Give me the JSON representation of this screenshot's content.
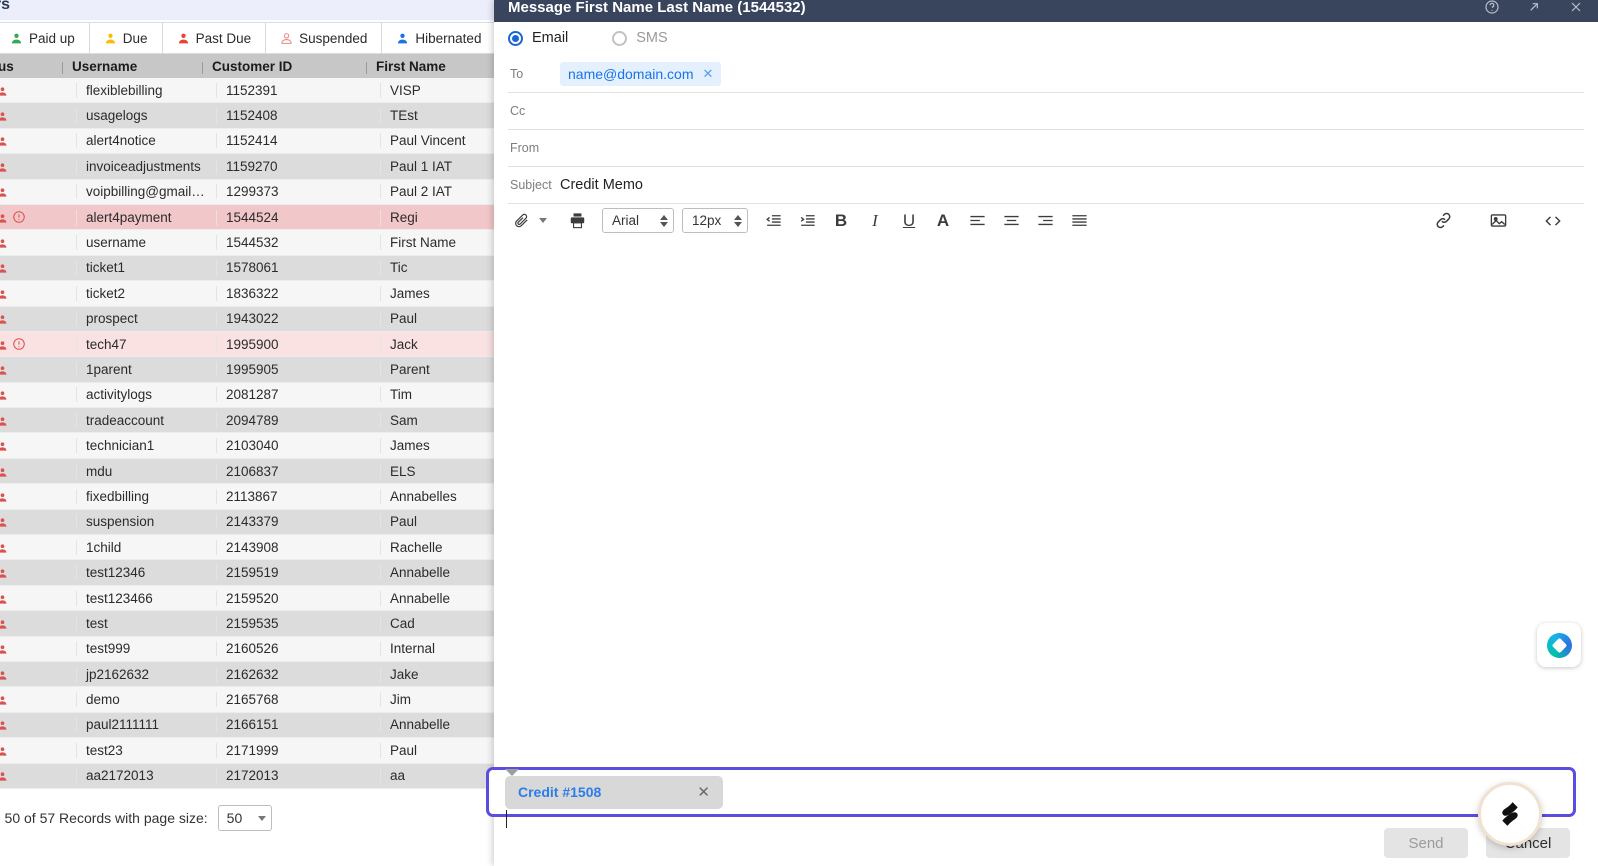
{
  "background_app": {
    "page_title": "ers",
    "tabs": [
      {
        "label": "Paid up",
        "icon": "person-icon",
        "color": "#34a853"
      },
      {
        "label": "Due",
        "icon": "person-icon",
        "color": "#fbbc04"
      },
      {
        "label": "Past Due",
        "icon": "person-icon",
        "color": "#ea4335"
      },
      {
        "label": "Suspended",
        "icon": "person-outline-icon",
        "color": "#ea8b86"
      },
      {
        "label": "Hibernated",
        "icon": "person-icon",
        "color": "#1a73e8"
      }
    ],
    "table": {
      "columns": [
        "atus",
        "Username",
        "Customer ID",
        "First Name"
      ],
      "rows": [
        {
          "username": "flexiblebilling",
          "customer_id": "1152391",
          "first_name": "VISP",
          "state": "odd",
          "alert": false
        },
        {
          "username": "usagelogs",
          "customer_id": "1152408",
          "first_name": "TEst",
          "state": "even",
          "alert": false
        },
        {
          "username": "alert4notice",
          "customer_id": "1152414",
          "first_name": "Paul Vincent",
          "state": "odd",
          "alert": false
        },
        {
          "username": "invoiceadjustments",
          "customer_id": "1159270",
          "first_name": "Paul 1 IAT",
          "state": "even",
          "alert": false
        },
        {
          "username": "voipbilling@gmail.co…",
          "customer_id": "1299373",
          "first_name": "Paul 2 IAT",
          "state": "odd",
          "alert": false
        },
        {
          "username": "alert4payment",
          "customer_id": "1544524",
          "first_name": "Regi",
          "state": "alert-a",
          "alert": true
        },
        {
          "username": "username",
          "customer_id": "1544532",
          "first_name": "First Name",
          "state": "odd",
          "alert": false
        },
        {
          "username": "ticket1",
          "customer_id": "1578061",
          "first_name": "Tic",
          "state": "even",
          "alert": false
        },
        {
          "username": "ticket2",
          "customer_id": "1836322",
          "first_name": "James",
          "state": "odd",
          "alert": false
        },
        {
          "username": "prospect",
          "customer_id": "1943022",
          "first_name": "Paul",
          "state": "even",
          "alert": false
        },
        {
          "username": "tech47",
          "customer_id": "1995900",
          "first_name": "Jack",
          "state": "alert-b",
          "alert": true
        },
        {
          "username": "1parent",
          "customer_id": "1995905",
          "first_name": "Parent",
          "state": "even",
          "alert": false
        },
        {
          "username": "activitylogs",
          "customer_id": "2081287",
          "first_name": "Tim",
          "state": "odd",
          "alert": false
        },
        {
          "username": "tradeaccount",
          "customer_id": "2094789",
          "first_name": "Sam",
          "state": "even",
          "alert": false
        },
        {
          "username": "technician1",
          "customer_id": "2103040",
          "first_name": "James",
          "state": "odd",
          "alert": false
        },
        {
          "username": "mdu",
          "customer_id": "2106837",
          "first_name": "ELS",
          "state": "even",
          "alert": false
        },
        {
          "username": "fixedbilling",
          "customer_id": "2113867",
          "first_name": "Annabelles",
          "state": "odd",
          "alert": false
        },
        {
          "username": "suspension",
          "customer_id": "2143379",
          "first_name": "Paul",
          "state": "even",
          "alert": false
        },
        {
          "username": "1child",
          "customer_id": "2143908",
          "first_name": "Rachelle",
          "state": "odd",
          "alert": false
        },
        {
          "username": "test12346",
          "customer_id": "2159519",
          "first_name": "Annabelle",
          "state": "even",
          "alert": false
        },
        {
          "username": "test123466",
          "customer_id": "2159520",
          "first_name": "Annabelle",
          "state": "odd",
          "alert": false
        },
        {
          "username": "test",
          "customer_id": "2159535",
          "first_name": "Cad",
          "state": "even",
          "alert": false
        },
        {
          "username": "test999",
          "customer_id": "2160526",
          "first_name": "Internal",
          "state": "odd",
          "alert": false
        },
        {
          "username": "jp2162632",
          "customer_id": "2162632",
          "first_name": "Jake",
          "state": "even",
          "alert": false
        },
        {
          "username": "demo",
          "customer_id": "2165768",
          "first_name": "Jim",
          "state": "odd",
          "alert": false
        },
        {
          "username": "paul2111111",
          "customer_id": "2166151",
          "first_name": "Annabelle",
          "state": "even",
          "alert": false
        },
        {
          "username": "test23",
          "customer_id": "2171999",
          "first_name": "Paul",
          "state": "odd",
          "alert": false
        },
        {
          "username": "aa2172013",
          "customer_id": "2172013",
          "first_name": "aa",
          "state": "even",
          "alert": false
        }
      ]
    },
    "pager": {
      "text": "- 50 of 57 Records with page size:",
      "page_size": "50"
    }
  },
  "modal": {
    "title": "Message First Name Last Name (1544532)",
    "header_icons": [
      "help-circle-icon",
      "expand-arrow-icon",
      "close-icon"
    ],
    "channel": {
      "email_label": "Email",
      "sms_label": "SMS",
      "selected": "Email"
    },
    "fields": [
      {
        "label": "To",
        "value": "name@domain.com",
        "type": "chip"
      },
      {
        "label": "Cc",
        "value": "",
        "type": "text"
      },
      {
        "label": "From",
        "value": "",
        "type": "text"
      },
      {
        "label": "Subject",
        "value": "Credit Memo",
        "type": "text"
      }
    ],
    "toolbar": {
      "font_family": "Arial",
      "font_size": "12px",
      "left_icons": [
        "paperclip-icon",
        "chevron-down-icon",
        "printer-icon"
      ],
      "format_buttons": [
        {
          "name": "outdent-icon",
          "glyph": ""
        },
        {
          "name": "indent-icon",
          "glyph": ""
        },
        {
          "name": "bold-icon",
          "glyph": "B"
        },
        {
          "name": "italic-icon",
          "glyph": "I"
        },
        {
          "name": "underline-icon",
          "glyph": "U"
        },
        {
          "name": "font-color-icon",
          "glyph": "A"
        },
        {
          "name": "align-left-icon",
          "glyph": ""
        },
        {
          "name": "align-center-icon",
          "glyph": ""
        },
        {
          "name": "align-right-icon",
          "glyph": ""
        },
        {
          "name": "align-justify-icon",
          "glyph": ""
        }
      ],
      "right_icons": [
        "link-icon",
        "insert-image-icon",
        "source-code-icon"
      ]
    },
    "body_text": "",
    "attachment": {
      "name": "Credit #1508",
      "remove_label": "✕",
      "highlight_color": "#5b4de0"
    },
    "footer": {
      "send_label": "Send",
      "cancel_label": "Cancel",
      "send_disabled": true
    }
  },
  "overlays": {
    "widget_icon": "chat-widget-icon",
    "cursor_badge": "cursor-badge-icon"
  }
}
